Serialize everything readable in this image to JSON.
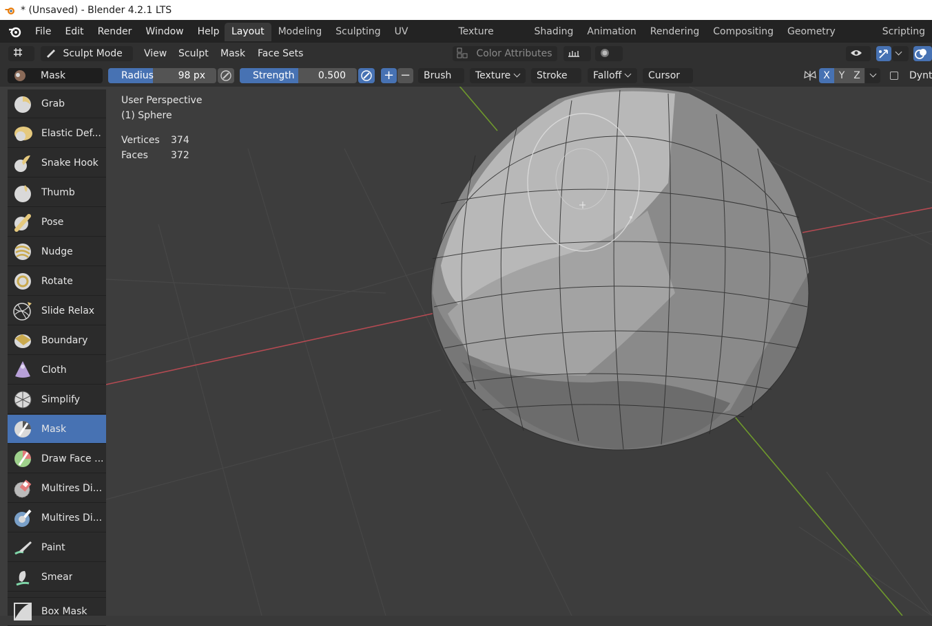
{
  "window": {
    "title": "* (Unsaved) - Blender 4.2.1 LTS"
  },
  "menu": {
    "items": [
      "File",
      "Edit",
      "Render",
      "Window",
      "Help"
    ]
  },
  "workspaces": [
    "Layout",
    "Modeling",
    "Sculpting",
    "UV Editing",
    "Texture Paint",
    "Shading",
    "Animation",
    "Rendering",
    "Compositing",
    "Geometry Nodes",
    "Scripting"
  ],
  "header": {
    "mode": "Sculpt Mode",
    "menus": [
      "View",
      "Sculpt",
      "Mask",
      "Face Sets"
    ],
    "color_attributes": "Color Attributes"
  },
  "tool_settings": {
    "brush_name": "Mask",
    "radius_label": "Radius",
    "radius_value": "98 px",
    "strength_label": "Strength",
    "strength_value": "0.500",
    "strength_fraction": 0.5,
    "add_sign": "+",
    "subtract_sign": "−",
    "dropdowns": [
      "Brush",
      "Texture",
      "Stroke",
      "Falloff",
      "Cursor"
    ],
    "axes": [
      "X",
      "Y",
      "Z"
    ],
    "dyntopo": "Dynto"
  },
  "viewport": {
    "perspective": "User Perspective",
    "object": "(1) Sphere",
    "stats": [
      {
        "label": "Vertices",
        "value": "374"
      },
      {
        "label": "Faces",
        "value": "372"
      }
    ]
  },
  "tools": [
    {
      "label": "Grab",
      "icon": "grab-brush-icon"
    },
    {
      "label": "Elastic Def...",
      "icon": "elastic-deform-brush-icon"
    },
    {
      "label": "Snake Hook",
      "icon": "snake-hook-brush-icon"
    },
    {
      "label": "Thumb",
      "icon": "thumb-brush-icon"
    },
    {
      "label": "Pose",
      "icon": "pose-brush-icon"
    },
    {
      "label": "Nudge",
      "icon": "nudge-brush-icon"
    },
    {
      "label": "Rotate",
      "icon": "rotate-brush-icon"
    },
    {
      "label": "Slide Relax",
      "icon": "slide-relax-brush-icon"
    },
    {
      "label": "Boundary",
      "icon": "boundary-brush-icon"
    },
    {
      "label": "Cloth",
      "icon": "cloth-brush-icon"
    },
    {
      "label": "Simplify",
      "icon": "simplify-brush-icon"
    },
    {
      "label": "Mask",
      "icon": "mask-brush-icon",
      "active": true
    },
    {
      "label": "Draw Face ...",
      "icon": "draw-face-sets-brush-icon"
    },
    {
      "label": "Multires Di...",
      "icon": "multires-displacement-eraser-icon"
    },
    {
      "label": "Multires Di...",
      "icon": "multires-displacement-smear-icon"
    },
    {
      "label": "Paint",
      "icon": "paint-brush-icon"
    },
    {
      "label": "Smear",
      "icon": "smear-brush-icon"
    },
    {
      "label": "Box Mask",
      "icon": "box-mask-icon"
    }
  ],
  "colors": {
    "accent": "#4772b3",
    "x_axis": "#b54a52",
    "y_axis": "#6f9a2c"
  }
}
